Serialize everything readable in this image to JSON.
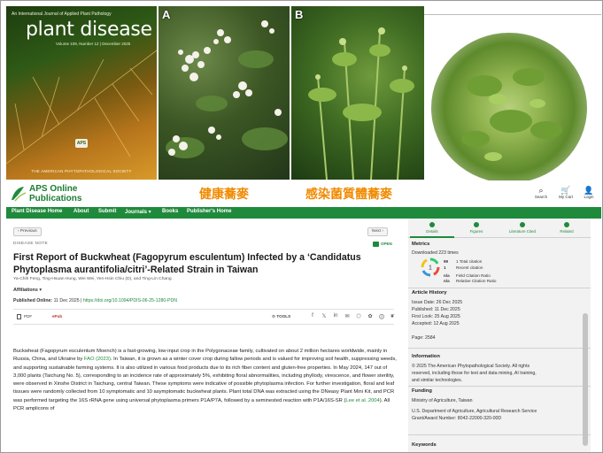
{
  "cover": {
    "journal_line": "An International Journal of Applied Plant Pathology",
    "title": "plant disease",
    "volume": "Volume 109, Number 12 | December 2025",
    "badge": "APS",
    "society": "THE AMERICAN PHYTOPATHOLOGICAL SOCIETY"
  },
  "photos": {
    "a_label": "A",
    "b_label": "B"
  },
  "annotations": {
    "healthy": "健康蕎麥",
    "infected": "感染菌質體蕎麥"
  },
  "header": {
    "logo_line1": "APS Online",
    "logo_line2": "Publications",
    "icons": [
      {
        "label": "Search",
        "glyph": "⌕"
      },
      {
        "label": "My Cart",
        "glyph": "🛒"
      },
      {
        "label": "Login",
        "glyph": "👤"
      }
    ]
  },
  "nav": [
    "Plant Disease Home",
    "About",
    "Submit",
    "Journals ▾",
    "Books",
    "Publisher's Home"
  ],
  "article": {
    "previous": "‹ Previous",
    "next": "Next ›",
    "note_type": "DISEASE NOTE",
    "open": "OPEN",
    "title": "First Report of Buckwheat (Fagopyrum esculentum) Infected by a ‘Candidatus Phytoplasma aurantifolia/citri’-Related Strain in Taiwan",
    "authors": "Ya-Chih Feng, Ting-Hsuan Hung, Wei Wei, Yen-Hsin Chiu (D), and Ting-Lin Chang",
    "affiliations": "Affiliations ▾",
    "published_label": "Published Online:",
    "published_date": "11 Dec 2025",
    "doi": "https://doi.org/10.1094/PDIS-06-25-1280-PDN",
    "pdf": "PDF",
    "epub": "ePub",
    "tools": "TOOLS",
    "share_icons": [
      "f",
      "𝕏",
      "in",
      "✉",
      "⬡",
      "✿",
      "🛈",
      "❦"
    ],
    "abstract_segments": [
      {
        "t": "Buckwheat (Fagopyrum esculentum Moench) is a fast-growing, low-input crop in the Polygonaceae family, cultivated on about 2 million hectares worldwide, mainly in Russia, China, and Ukraine by "
      },
      {
        "t": "FAO (2023)",
        "link": true
      },
      {
        "t": ". In Taiwan, it is grown as a winter cover crop during fallow periods and is valued for improving soil health, suppressing weeds, and supporting sustainable farming systems. It is also utilized in various food products due to its rich fiber content and gluten-free properties. In May 2024, 147 out of 3,000 plants (Taichung No. 5), corresponding to an incidence rate of approximately 5%, exhibiting floral abnormalities, including phyllody, virescence, and flower sterility, were observed in Xinshe District in Taichung, central Taiwan. These symptoms were indicative of possible phytoplasma infection. For further investigation, floral and leaf tissues were randomly collected from 10 symptomatic and 10 asymptomatic buckwheat plants. Plant total DNA was extracted using the DNeasy Plant Mini Kit, and PCR was performed targeting the 16S rRNA gene using universal phytoplasma primers P1A/P7A, followed by a seminested reaction with P1A/16S-SR ("
      },
      {
        "t": "Lee et al. 2004",
        "link": true
      },
      {
        "t": "). All PCR amplicons of"
      }
    ]
  },
  "side": {
    "tabs": [
      "Details",
      "Figures",
      "Literature Cited",
      "Related"
    ],
    "metrics_heading": "Metrics",
    "downloaded": "Downloaded 223 times",
    "donut_value": "1",
    "metric_rows": [
      {
        "n": "99",
        "t": "1   Total citation"
      },
      {
        "n": "1",
        "t": "Recent citation"
      },
      {
        "n": "n/a",
        "t": "Field Citation Ratio"
      },
      {
        "n": "n/a",
        "t": "Relative Citation Ratio"
      }
    ],
    "history_heading": "Article History",
    "history": [
      "Issue Date:  26 Dec 2025",
      "Published:   11 Dec 2025",
      "First Look:  25 Aug 2025",
      "Accepted:    12 Aug 2025"
    ],
    "page": "Page: 2584",
    "information_heading": "Information",
    "information_lines": [
      "© 2025 The American Phytopathological Society. All rights",
      "reserved, including those for text and data mining, AI training,",
      "and similar technologies."
    ],
    "funding_heading": "Funding",
    "funding_lines": [
      "Ministry of Agriculture, Taiwan",
      "U.S. Department of Agriculture, Agricultural Research Service",
      "Grant/Award Number: 8042-22000-320-00D"
    ],
    "keywords_heading": "Keywords"
  },
  "colors": {
    "brand_green": "#1f8a3c",
    "annotation_orange": "#f08a00",
    "panel_bg": "#f2f2f2"
  }
}
